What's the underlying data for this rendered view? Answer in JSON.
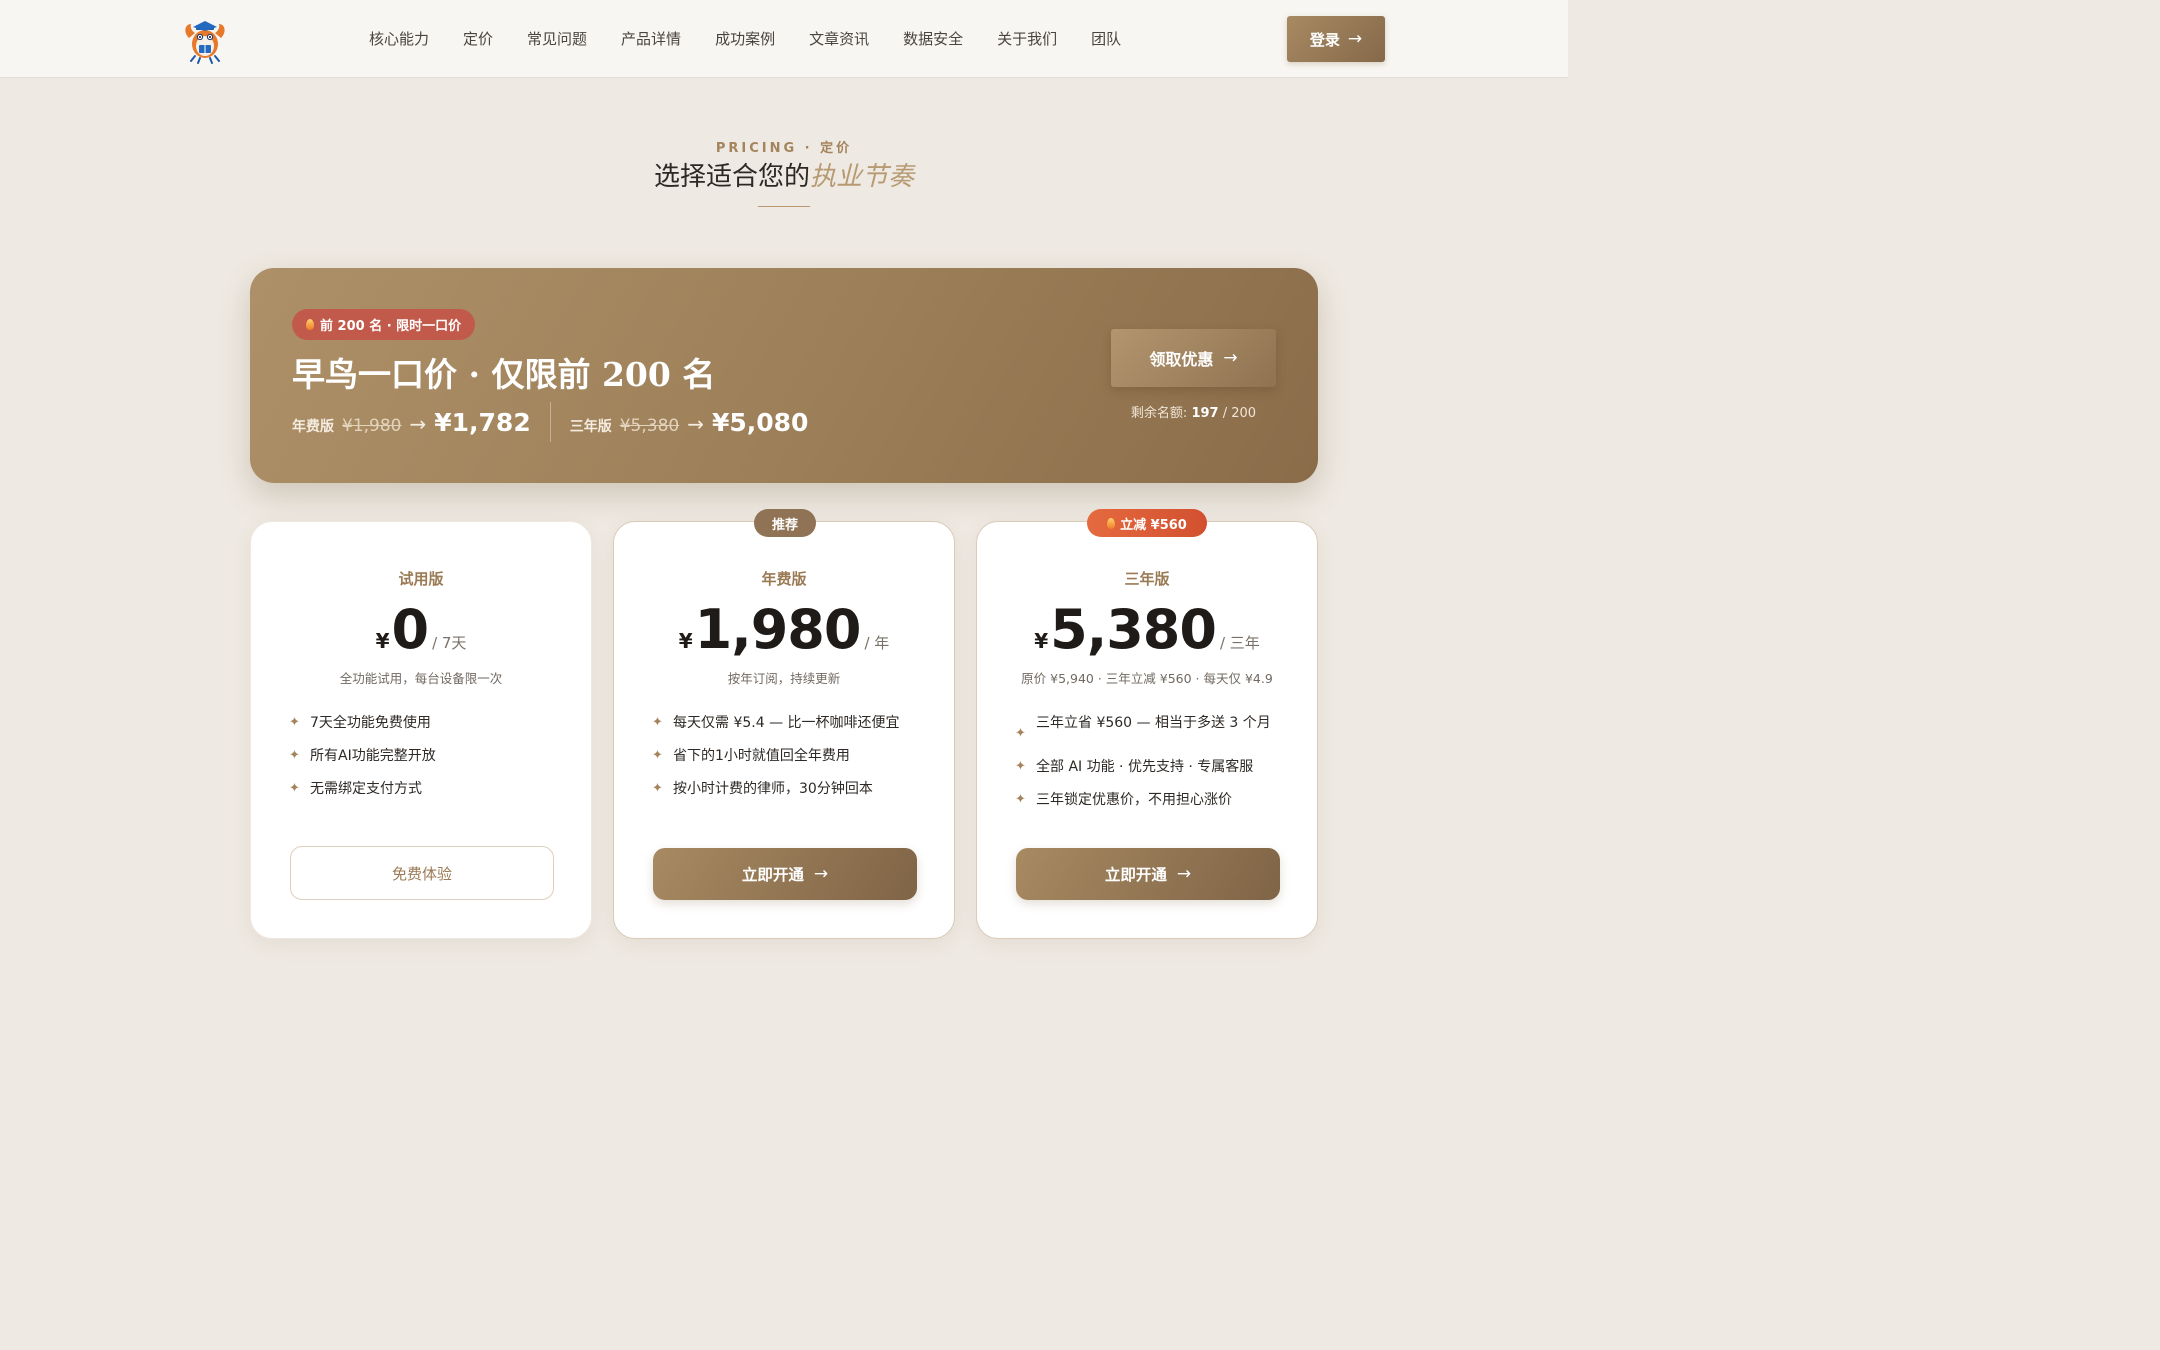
{
  "nav": {
    "logo_icon": "lobster-mascot-icon",
    "items": [
      "核心能力",
      "定价",
      "常见问题",
      "产品详情",
      "成功案例",
      "文章资讯",
      "数据安全",
      "关于我们",
      "团队"
    ],
    "login_label": "登录",
    "arrow": "→"
  },
  "section": {
    "eyebrow": "PRICING · 定价",
    "title_main": "选择适合您的",
    "title_accent": "执业节奏"
  },
  "promo": {
    "badge": "前 200 名 · 限时一口价",
    "title": "早鸟一口价 · 仅限前 200 名",
    "annual": {
      "label": "年费版",
      "old": "¥1,980",
      "arrow": "→",
      "new": "¥1,782"
    },
    "three_year": {
      "label": "三年版",
      "old": "¥5,380",
      "arrow": "→",
      "new": "¥5,080"
    },
    "cta_label": "领取优惠",
    "cta_arrow": "→",
    "remaining_label": "剩余名额:",
    "remaining_count": "197",
    "remaining_total": "/ 200"
  },
  "plans": [
    {
      "name": "试用版",
      "currency": "¥",
      "amount": "0",
      "unit": "/ 7天",
      "desc": "全功能试用，每台设备限一次",
      "features": [
        "7天全功能免费使用",
        "所有AI功能完整开放",
        "无需绑定支付方式"
      ],
      "button": "免费体验"
    },
    {
      "tag": "推荐",
      "name": "年费版",
      "currency": "¥",
      "amount": "1,980",
      "unit": "/ 年",
      "desc": "按年订阅，持续更新",
      "features": [
        "每天仅需 ¥5.4 — 比一杯咖啡还便宜",
        "省下的1小时就值回全年费用",
        "按小时计费的律师，30分钟回本"
      ],
      "button": "立即开通",
      "button_arrow": "→"
    },
    {
      "tag": "立减 ¥560",
      "name": "三年版",
      "currency": "¥",
      "amount": "5,380",
      "unit": "/ 三年",
      "desc": "原价 ¥5,940 · 三年立减 ¥560 · 每天仅 ¥4.9",
      "features": [
        "三年立省 ¥560 — 相当于多送 3 个月",
        "全部 AI 功能 · 优先支持 · 专属客服",
        "三年锁定优惠价，不用担心涨价"
      ],
      "button": "立即开通",
      "button_arrow": "→"
    }
  ],
  "colors": {
    "accent": "#a4845d",
    "background": "#eee9e2",
    "badge_red": "#c25a4c",
    "tag_orange": "#e56a3f"
  }
}
